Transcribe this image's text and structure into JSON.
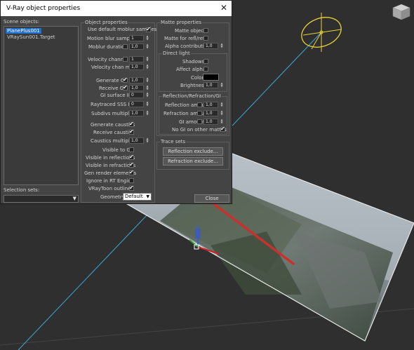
{
  "window": {
    "title": "V-Ray object properties",
    "close_glyph": "✕"
  },
  "scene_objects": {
    "label": "Scene objects:",
    "items": [
      "PlanePlus001",
      "VRaySun001.Target"
    ],
    "selected_index": 0
  },
  "selection_sets": {
    "label": "Selection sets:",
    "value": ""
  },
  "object_properties": {
    "title": "Object properties",
    "use_default_moblur": {
      "label": "Use default moblur samples",
      "checked": true
    },
    "motion_blur_samples": {
      "label": "Motion blur samples",
      "value": "1"
    },
    "moblur_duration": {
      "label": "Moblur duration",
      "value": "1,0"
    },
    "velocity_channel": {
      "label": "Velocity channel",
      "value": "1"
    },
    "velocity_chan_mult": {
      "label": "Velocity chan mult",
      "value": "1,0"
    },
    "generate_gi": {
      "label": "Generate GI",
      "checked": true,
      "value": "1,0"
    },
    "receive_gi": {
      "label": "Receive GI",
      "checked": true,
      "value": "1,0"
    },
    "gi_surface_id": {
      "label": "GI surface ID",
      "value": "0"
    },
    "raytraced_sss_id": {
      "label": "Raytraced SSS ID",
      "value": "0"
    },
    "subdivs_multiplier": {
      "label": "Subdivs multiplier",
      "value": "1,0"
    },
    "generate_caustics": {
      "label": "Generate caustics",
      "checked": true
    },
    "receive_caustics": {
      "label": "Receive caustics",
      "checked": true
    },
    "caustics_multiplier": {
      "label": "Caustics multiplier",
      "value": "1,0"
    },
    "visible_to_gi": {
      "label": "Visible to GI",
      "checked": false
    },
    "visible_in_reflections": {
      "label": "Visible in reflections",
      "checked": true
    },
    "visible_in_refractions": {
      "label": "Visible in refractions",
      "checked": true
    },
    "gen_render_elements": {
      "label": "Gen render elements",
      "checked": true
    },
    "ignore_in_rt_engine": {
      "label": "Ignore in RT Engine",
      "checked": false
    },
    "vraytoon_outlines": {
      "label": "VRayToon outlines",
      "checked": true
    },
    "geometry": {
      "label": "Geometry",
      "value": "Default"
    }
  },
  "matte_properties": {
    "title": "Matte properties",
    "matte_object": {
      "label": "Matte object",
      "checked": false
    },
    "matte_for_refl_refr": {
      "label": "Matte for refl/refr",
      "checked": false
    },
    "alpha_contribution": {
      "label": "Alpha contribution",
      "value": "1,0"
    },
    "direct_light": {
      "title": "Direct light",
      "shadows": {
        "label": "Shadows",
        "checked": false
      },
      "affect_alpha": {
        "label": "Affect alpha",
        "checked": false
      },
      "color": {
        "label": "Color",
        "value": "#000000"
      },
      "brightness": {
        "label": "Brightness",
        "value": "1,0"
      }
    },
    "rrg": {
      "title": "Reflection/Refraction/GI",
      "reflection_amount": {
        "label": "Reflection amount",
        "value": "1,0"
      },
      "refraction_amount": {
        "label": "Refraction amount",
        "value": "1,0"
      },
      "gi_amount": {
        "label": "GI amount",
        "value": "1,0"
      },
      "no_gi_on_other_mattes": {
        "label": "No GI on other mattes",
        "checked": true
      }
    }
  },
  "trace_sets": {
    "title": "Trace sets",
    "reflection_exclude": "Reflection exclude...",
    "refraction_exclude": "Refraction exclude..."
  },
  "close_button": "Close",
  "colors": {
    "annotation_arrow": "#c8312c",
    "light_gizmo": "#e8d23a",
    "sun_line": "#3aa9d6",
    "selection_highlight": "#1f6fd1"
  },
  "viewport": {
    "icons": [
      "viewcube-icon",
      "sun-light-icon",
      "transform-gizmo-icon"
    ]
  }
}
